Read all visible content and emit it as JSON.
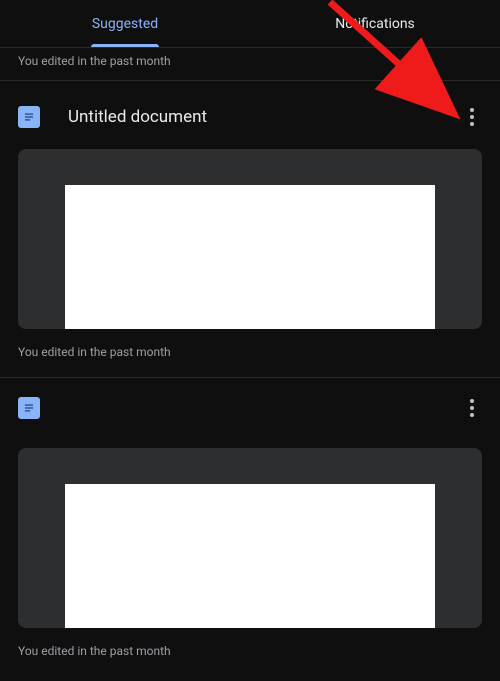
{
  "tabs": {
    "suggested": "Suggested",
    "notifications": "Notifications"
  },
  "top_subtitle": "You edited in the past month",
  "documents": [
    {
      "title": "Untitled document",
      "meta": "You edited in the past month"
    },
    {
      "title": "",
      "meta": "You edited in the past month"
    }
  ]
}
